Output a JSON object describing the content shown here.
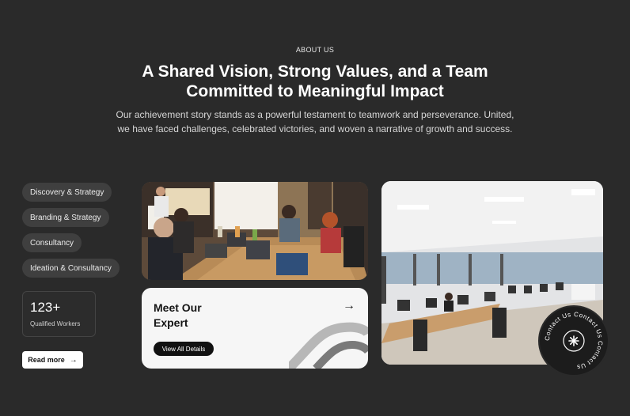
{
  "about": {
    "eyebrow": "ABOUT US",
    "headline_line1": "A Shared Vision, Strong Values, and a Team",
    "headline_line2": "Committed to Meaningful Impact",
    "subtext_line1": "Our achievement story stands as a powerful testament to teamwork and perseverance. United,",
    "subtext_line2": "we have faced challenges, celebrated victories, and woven a narrative of growth and success."
  },
  "services": [
    {
      "label": "Discovery & Strategy"
    },
    {
      "label": "Branding & Strategy"
    },
    {
      "label": "Consultancy"
    },
    {
      "label": "Ideation & Consultancy"
    }
  ],
  "stat": {
    "value": "123+",
    "label": "Qualified Workers"
  },
  "read_more": {
    "label": "Read more",
    "icon": "arrow-right-icon"
  },
  "expert": {
    "title_line1": "Meet Our",
    "title_line2": "Expert",
    "button": "View All Details",
    "icon": "arrow-right-icon"
  },
  "contact_badge": {
    "ring_text": "Contact Us  Contact Us  Contact Us  ",
    "icon": "asterisk-icon"
  },
  "colors": {
    "background": "#2a2a2a",
    "pill": "#3f3f3f",
    "card": "#f6f6f6",
    "accent_dark": "#111111"
  }
}
